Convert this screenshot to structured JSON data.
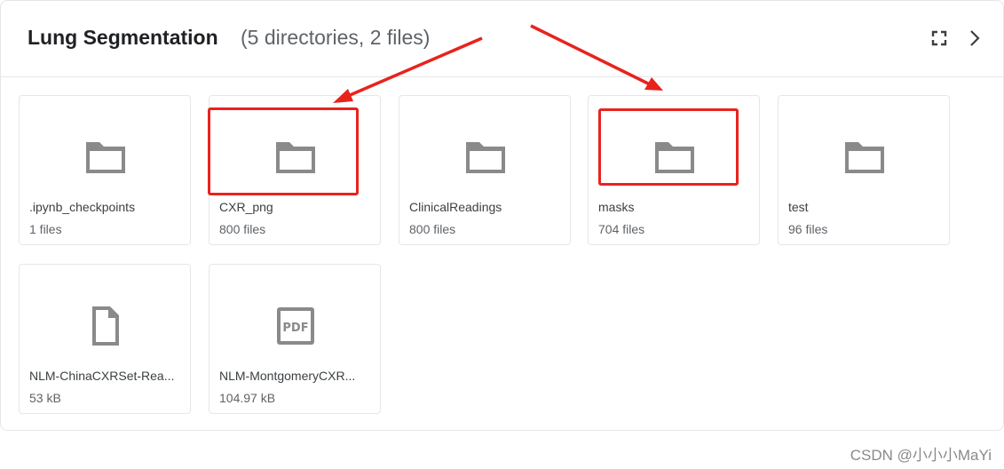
{
  "header": {
    "title": "Lung Segmentation",
    "subtitle": "(5 directories, 2 files)"
  },
  "items": [
    {
      "name": ".ipynb_checkpoints",
      "meta": "1 files",
      "icon": "folder-icon"
    },
    {
      "name": "CXR_png",
      "meta": "800 files",
      "icon": "folder-icon"
    },
    {
      "name": "ClinicalReadings",
      "meta": "800 files",
      "icon": "folder-icon"
    },
    {
      "name": "masks",
      "meta": "704 files",
      "icon": "folder-icon"
    },
    {
      "name": "test",
      "meta": "96 files",
      "icon": "folder-icon"
    },
    {
      "name": "NLM-ChinaCXRSet-Rea...",
      "meta": "53 kB",
      "icon": "file-icon"
    },
    {
      "name": "NLM-MontgomeryCXR...",
      "meta": "104.97 kB",
      "icon": "pdf-icon",
      "icon_text": "PDF"
    }
  ],
  "colors": {
    "annotation": "#e8231d",
    "icon": "#8a8a8a"
  },
  "watermark": "CSDN @小小小MaYi"
}
